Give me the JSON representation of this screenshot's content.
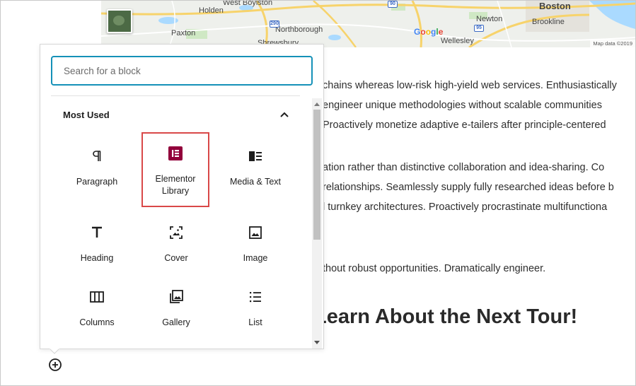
{
  "map": {
    "labels": {
      "holden": "Holden",
      "west_boylston": "West Boylston",
      "boston": "Boston",
      "newton": "Newton",
      "brookline": "Brookline",
      "paxton": "Paxton",
      "northborough": "Northborough",
      "wellesley": "Wellesley",
      "shrewsbury": "Shrewsbury",
      "route_290": "290",
      "route_95": "95",
      "route_90": "90"
    },
    "google_letters": [
      "G",
      "o",
      "o",
      "g",
      "l",
      "e"
    ],
    "attribution": "Map data ©2019"
  },
  "content": {
    "lines": [
      "chains whereas low-risk high-yield web services. Enthusiastically",
      "engineer unique methodologies without scalable communities",
      "Proactively monetize adaptive e-tailers after principle-centered",
      "ation rather than distinctive collaboration and idea-sharing. Co",
      "relationships. Seamlessly supply fully researched ideas before b",
      "l turnkey architectures. Proactively procrastinate multifunctiona",
      "thout robust opportunities. Dramatically engineer."
    ],
    "heading": "Learn About the Next Tour!"
  },
  "inserter": {
    "search_placeholder": "Search for a block",
    "panel_title": "Most Used",
    "blocks": [
      {
        "label": "Paragraph",
        "icon": "paragraph-icon"
      },
      {
        "label": "Elementor Library",
        "icon": "elementor-icon"
      },
      {
        "label": "Media & Text",
        "icon": "media-text-icon"
      },
      {
        "label": "Heading",
        "icon": "heading-icon"
      },
      {
        "label": "Cover",
        "icon": "cover-icon"
      },
      {
        "label": "Image",
        "icon": "image-icon"
      },
      {
        "label": "Columns",
        "icon": "columns-icon"
      },
      {
        "label": "Gallery",
        "icon": "gallery-icon"
      },
      {
        "label": "List",
        "icon": "list-icon"
      }
    ]
  },
  "colors": {
    "search_focus": "#1591b8",
    "highlight": "#d94848",
    "elementor": "#92003b",
    "icon": "#1e1e1e"
  }
}
